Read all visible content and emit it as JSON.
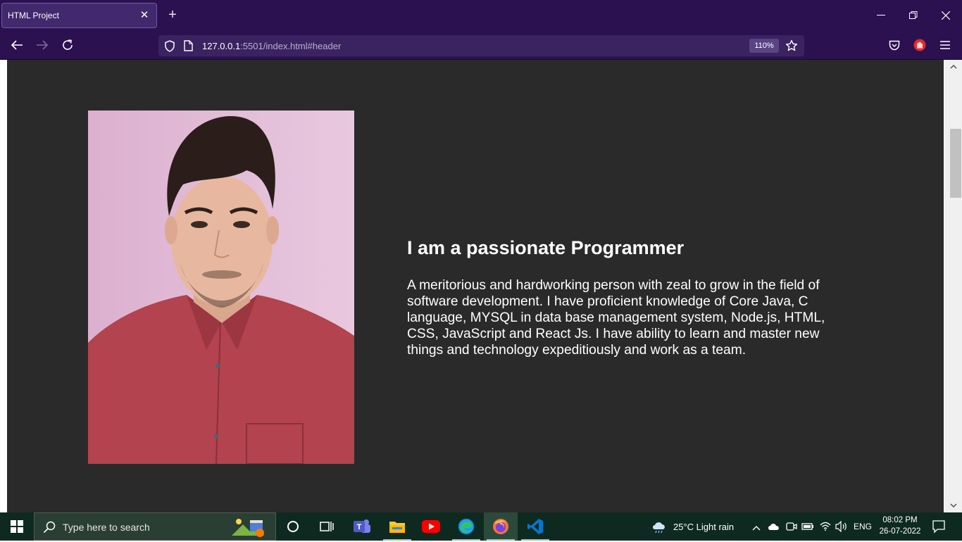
{
  "browser": {
    "tab_title": "HTML Project",
    "url_host": "127.0.0.1",
    "url_rest": ":5501/index.html#header",
    "zoom": "110%"
  },
  "page": {
    "heading": "I am a passionate Programmer",
    "paragraph": "A meritorious and hardworking person with zeal to grow in the field of software development. I have proficient knowledge of Core Java, C language, MYSQL in data base management system, Node.js, HTML, CSS, JavaScript and React Js. I have ability to learn and master new things and technology expeditiously and work as a team."
  },
  "taskbar": {
    "search_placeholder": "Type here to search",
    "weather": "25°C  Light rain",
    "language": "ENG",
    "time": "08:02 PM",
    "date": "26-07-2022"
  },
  "colors": {
    "browser_chrome": "#2b1150",
    "page_background": "#2a2a2a",
    "taskbar": "#0e2a20"
  }
}
